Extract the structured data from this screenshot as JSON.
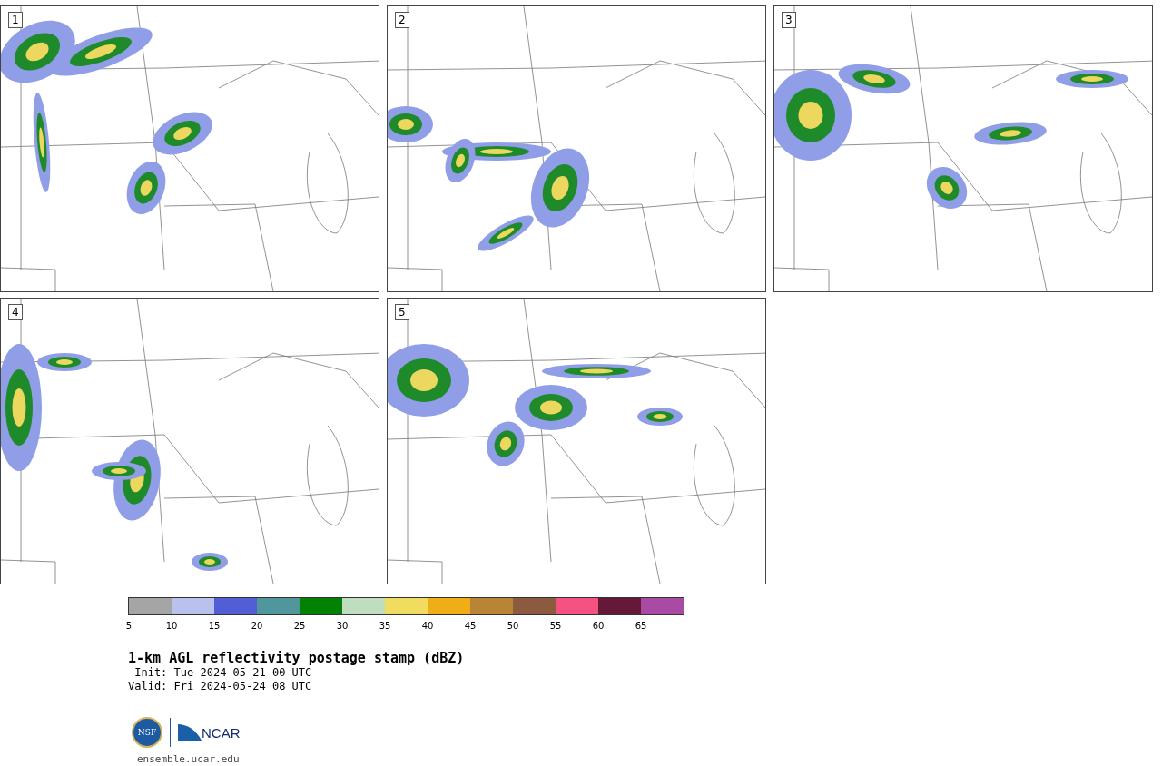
{
  "panels": [
    {
      "label": "1"
    },
    {
      "label": "2"
    },
    {
      "label": "3"
    },
    {
      "label": "4"
    },
    {
      "label": "5"
    }
  ],
  "colorbar": {
    "bins": [
      {
        "label": "5",
        "color": "#a5a5a5"
      },
      {
        "label": "10",
        "color": "#b8c2ec"
      },
      {
        "label": "15",
        "color": "#525ed6"
      },
      {
        "label": "20",
        "color": "#4f979c"
      },
      {
        "label": "25",
        "color": "#028102"
      },
      {
        "label": "30",
        "color": "#bedebf"
      },
      {
        "label": "35",
        "color": "#f0dc5e"
      },
      {
        "label": "40",
        "color": "#efad17"
      },
      {
        "label": "45",
        "color": "#b98433"
      },
      {
        "label": "50",
        "color": "#8b5a3f"
      },
      {
        "label": "55",
        "color": "#f45382"
      },
      {
        "label": "60",
        "color": "#661838"
      },
      {
        "label": "65",
        "color": "#a94ba5"
      }
    ]
  },
  "title": "1-km AGL reflectivity postage stamp (dBZ)",
  "init": " Init: Tue 2024-05-21 00 UTC",
  "valid": "Valid: Fri 2024-05-24 08 UTC",
  "logo": {
    "left": "NSF",
    "right": "NCAR"
  },
  "footer": "ensemble.ucar.edu"
}
